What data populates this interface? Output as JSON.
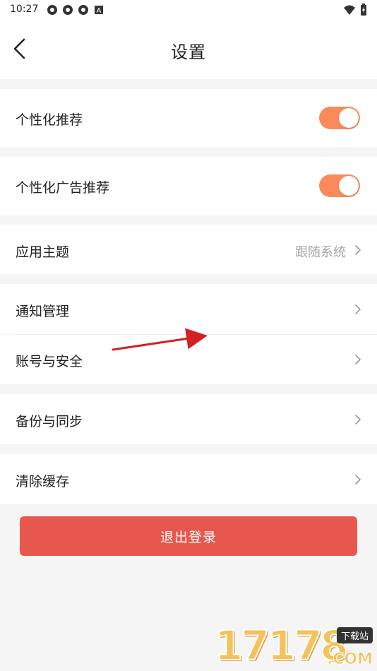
{
  "status_bar": {
    "time": "10:27",
    "icons": [
      "notification-icon",
      "notification-icon",
      "notification-icon",
      "a-badge-icon"
    ],
    "right_icons": [
      "wifi-icon",
      "battery-icon"
    ]
  },
  "header": {
    "title": "设置",
    "back_icon": "chevron-left-icon"
  },
  "settings": {
    "personalized_recommend": {
      "label": "个性化推荐",
      "enabled": true
    },
    "personalized_ads": {
      "label": "个性化广告推荐",
      "enabled": true
    },
    "app_theme": {
      "label": "应用主题",
      "value": "跟随系统"
    },
    "notification_manage": {
      "label": "通知管理"
    },
    "account_security": {
      "label": "账号与安全"
    },
    "backup_sync": {
      "label": "备份与同步"
    },
    "clear_cache": {
      "label": "清除缓存"
    }
  },
  "logout": {
    "label": "退出登录"
  },
  "watermark": {
    "number": "17178",
    "badge": "下载站",
    "suffix": ".COM"
  },
  "colors": {
    "toggle_on": "#fb8a5a",
    "logout_bg": "#e8574e",
    "secondary_text": "#a6a6a6",
    "annotation_arrow": "#d32020"
  }
}
